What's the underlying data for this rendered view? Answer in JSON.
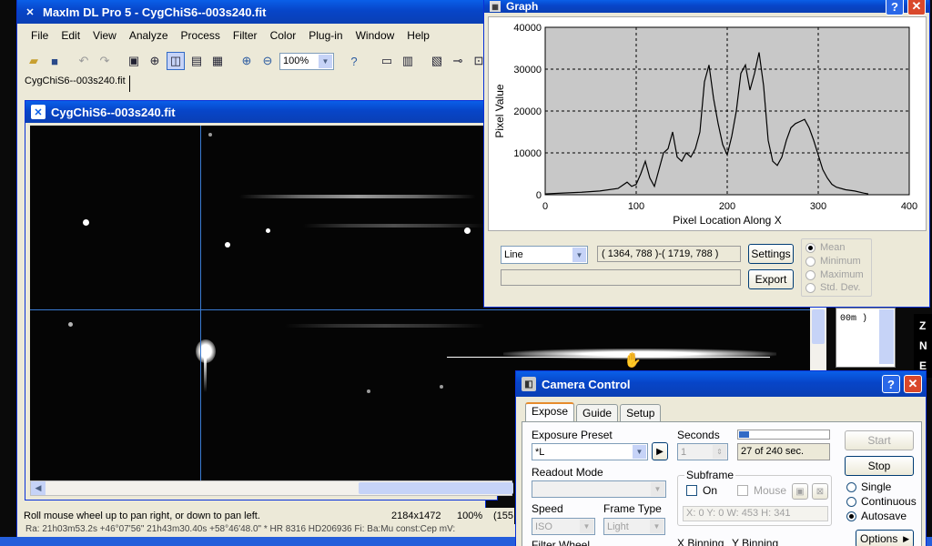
{
  "main_window": {
    "title": "MaxIm DL Pro 5 - CygChiS6--003s240.fit",
    "menu": [
      "File",
      "Edit",
      "View",
      "Analyze",
      "Process",
      "Filter",
      "Color",
      "Plug-in",
      "Window",
      "Help"
    ],
    "zoom": "100%",
    "doc_tab": "CygChiS6--003s240.fit"
  },
  "image_window": {
    "title": "CygChiS6--003s240.fit"
  },
  "status_bar": {
    "hint": "Roll mouse wheel up to pan right, or down to pan left.",
    "dimensions": "2184x1472",
    "zoom": "100%",
    "extra": "(155",
    "info_line": "Ra: 21h03m53.2s +46°07'56\"   21h43m30.40s +58°46'48.0\"  * HR 8316 HD206936 Fi:   Ba:Mu   const:Cep mV:"
  },
  "side_panel": {
    "text": "00m )",
    "letters": [
      "Z",
      "N",
      "E"
    ]
  },
  "graph_window": {
    "title": "Graph",
    "mode": "Line",
    "coords": "( 1364, 788 )-( 1719, 788 )",
    "settings_label": "Settings",
    "export_label": "Export",
    "stats": [
      "Mean",
      "Minimum",
      "Maximum",
      "Std. Dev."
    ]
  },
  "chart_data": {
    "type": "line",
    "xlabel": "Pixel Location Along X",
    "ylabel": "Pixel Value",
    "xlim": [
      0,
      400
    ],
    "ylim": [
      0,
      40000
    ],
    "xticks": [
      "0",
      "100",
      "200",
      "300",
      "400"
    ],
    "yticks": [
      "0",
      "10000",
      "20000",
      "30000",
      "40000"
    ],
    "grid": true,
    "x": [
      0,
      20,
      40,
      60,
      80,
      90,
      95,
      100,
      105,
      110,
      115,
      120,
      125,
      130,
      135,
      140,
      145,
      150,
      155,
      160,
      165,
      170,
      175,
      180,
      185,
      190,
      195,
      200,
      205,
      210,
      215,
      220,
      225,
      230,
      235,
      240,
      245,
      250,
      255,
      260,
      265,
      270,
      275,
      280,
      285,
      290,
      295,
      300,
      305,
      310,
      315,
      320,
      330,
      340,
      350,
      355
    ],
    "y": [
      200,
      400,
      600,
      900,
      1500,
      3000,
      2000,
      2500,
      5000,
      8000,
      4000,
      2000,
      6000,
      10000,
      11000,
      15000,
      9000,
      8000,
      10000,
      9000,
      11000,
      15000,
      27000,
      31000,
      23000,
      17000,
      12000,
      9500,
      14000,
      20000,
      29000,
      31000,
      25000,
      29000,
      34000,
      26000,
      13000,
      8000,
      7000,
      9000,
      13000,
      16000,
      17000,
      17500,
      18000,
      16000,
      13000,
      9500,
      6000,
      4000,
      2500,
      1800,
      1200,
      900,
      400,
      200
    ]
  },
  "camera_window": {
    "title": "Camera Control",
    "tabs": [
      "Expose",
      "Guide",
      "Setup"
    ],
    "exposure_preset_label": "Exposure Preset",
    "exposure_preset_value": "*L",
    "seconds_label": "Seconds",
    "seconds_value": "1",
    "progress_text": "27 of 240 sec.",
    "progress_fraction": 0.1125,
    "readout_mode_label": "Readout Mode",
    "subframe_label": "Subframe",
    "on_label": "On",
    "mouse_label": "Mouse",
    "subframe_coords": "X:  0 Y:   0 W: 453 H: 341",
    "speed_label": "Speed",
    "speed_value": "ISO",
    "frame_type_label": "Frame Type",
    "frame_type_value": "Light",
    "filter_wheel_label": "Filter Wheel",
    "x_binning_label": "X Binning",
    "y_binning_label": "Y Binning",
    "start_label": "Start",
    "stop_label": "Stop",
    "mode_single": "Single",
    "mode_continuous": "Continuous",
    "mode_autosave": "Autosave",
    "options_label": "Options"
  }
}
